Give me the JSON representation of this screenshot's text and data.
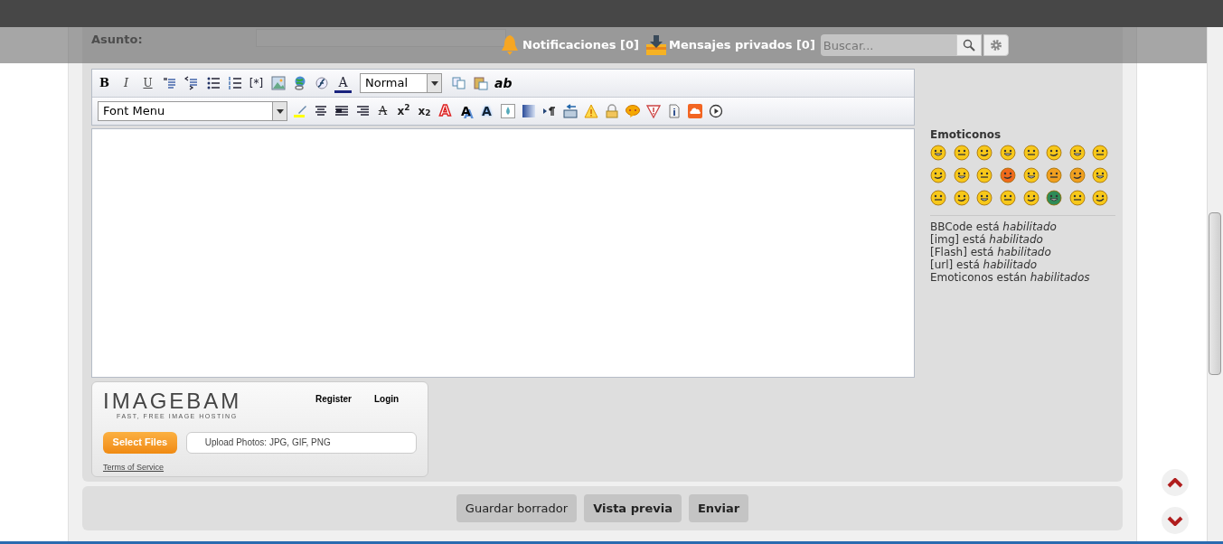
{
  "header": {
    "notifications": "Notificaciones [0]",
    "messages": "Mensajes privados [0]",
    "search": {
      "placeholder": "Buscar..."
    }
  },
  "subject": {
    "label": "Asunto:"
  },
  "toolbar": {
    "row_1": [
      {
        "kind": "bold",
        "glyph": "B"
      },
      {
        "kind": "italic",
        "glyph": "I"
      },
      {
        "kind": "underline",
        "glyph": "U"
      },
      {
        "kind": "quote"
      },
      {
        "kind": "code"
      },
      {
        "kind": "bullet-list"
      },
      {
        "kind": "numbered-list"
      },
      {
        "kind": "list-item",
        "glyph": "[*]"
      },
      {
        "kind": "image"
      },
      {
        "kind": "link"
      },
      {
        "kind": "flash"
      },
      {
        "kind": "font-color",
        "glyph": "A"
      },
      {
        "kind": "select",
        "value": "Normal"
      },
      {
        "kind": "copy"
      },
      {
        "kind": "paste"
      },
      {
        "kind": "spell",
        "glyph": "ab"
      }
    ],
    "row_2": [
      {
        "kind": "select",
        "value": "Font Menu"
      },
      {
        "kind": "highlight"
      },
      {
        "kind": "align-center"
      },
      {
        "kind": "justify"
      },
      {
        "kind": "align-right"
      },
      {
        "kind": "strike",
        "glyph": "A"
      },
      {
        "kind": "superscript",
        "glyph": "x$^{2}$"
      },
      {
        "kind": "subscript",
        "glyph": "x$_{2}$"
      },
      {
        "kind": "outline",
        "glyph": "A"
      },
      {
        "kind": "shadow",
        "glyph": "A"
      },
      {
        "kind": "glow",
        "glyph": "A"
      },
      {
        "kind": "droplet"
      },
      {
        "kind": "gradient"
      },
      {
        "kind": "direction"
      },
      {
        "kind": "insert"
      },
      {
        "kind": "warning"
      },
      {
        "kind": "lock"
      },
      {
        "kind": "speech"
      },
      {
        "kind": "alert"
      },
      {
        "kind": "info"
      },
      {
        "kind": "cloud"
      },
      {
        "kind": "play"
      }
    ]
  },
  "imagebam": {
    "logo": "IMAGEBAM",
    "tagline": "FAST, FREE IMAGE HOSTING",
    "register": "Register",
    "login": "Login",
    "select_button": "Select Files",
    "upload_hint": "Upload Photos: JPG, GIF, PNG",
    "terms": "Terms of Service"
  },
  "sidebar": {
    "title": "Emoticonos",
    "emoticons": [
      {
        "color": "#f7c81a"
      },
      {
        "color": "#f7c81a"
      },
      {
        "color": "#f7c81a"
      },
      {
        "color": "#f7c81a"
      },
      {
        "color": "#f7c81a"
      },
      {
        "color": "#f7c81a"
      },
      {
        "color": "#f7c81a"
      },
      {
        "color": "#f7c81a"
      },
      {
        "color": "#f7c81a"
      },
      {
        "color": "#f7c81a"
      },
      {
        "color": "#f7c81a"
      },
      {
        "color": "#f06a1c"
      },
      {
        "color": "#f7c81a"
      },
      {
        "color": "#f0a020"
      },
      {
        "color": "#f0a020"
      },
      {
        "color": "#f7c81a"
      },
      {
        "color": "#f7c81a"
      },
      {
        "color": "#f7c81a"
      },
      {
        "color": "#f7c81a"
      },
      {
        "color": "#f7c81a"
      },
      {
        "color": "#f7c81a"
      },
      {
        "color": "#2e8b57"
      },
      {
        "color": "#f7c81a"
      },
      {
        "color": "#f7c81a"
      }
    ],
    "status": [
      "BBCode está *habilitado*",
      "[img] está *habilitado*",
      "[Flash] está *habilitado*",
      "[url] está *habilitado*",
      "Emoticonos están *habilitados*"
    ]
  },
  "buttons": [
    "Guardar borrador",
    "Vista previa",
    "Enviar"
  ]
}
